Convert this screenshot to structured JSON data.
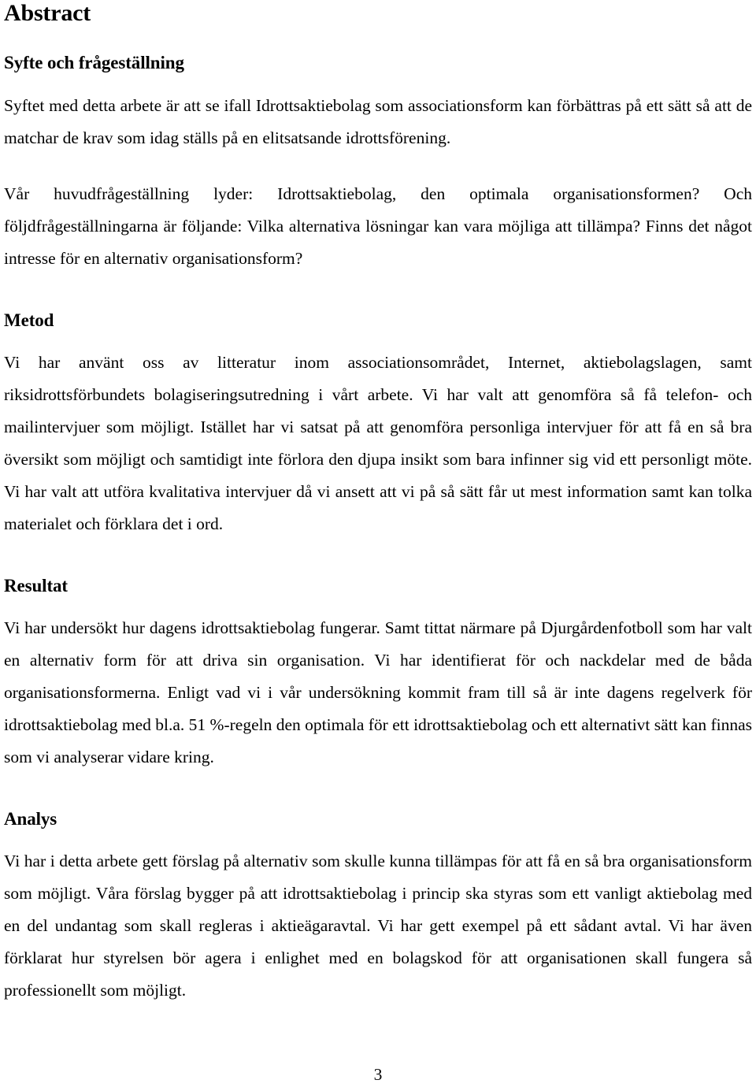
{
  "document": {
    "title": "Abstract",
    "page_number": "3",
    "sections": [
      {
        "id": "syfte",
        "heading": "Syfte och frågeställning",
        "paragraphs": [
          "Syftet med detta arbete är att se ifall Idrottsaktiebolag som associationsform kan förbättras på ett sätt så att de matchar de krav som idag ställs på en elitsatsande idrottsförening.",
          "Vår huvudfrågeställning lyder: Idrottsaktiebolag, den optimala organisationsformen? Och följdfrågeställningarna är följande: Vilka alternativa lösningar kan vara möjliga att tillämpa? Finns det något intresse för en alternativ organisationsform?"
        ]
      },
      {
        "id": "metod",
        "heading": "Metod",
        "paragraphs": [
          "Vi har använt oss av litteratur inom associationsområdet, Internet, aktiebolagslagen, samt riksidrottsförbundets bolagiseringsutredning i vårt arbete. Vi har valt att genomföra så få telefon- och mailintervjuer som möjligt. Istället har vi satsat på att genomföra personliga intervjuer för att få en så bra översikt som möjligt och samtidigt inte förlora den djupa insikt som bara infinner sig vid ett personligt möte. Vi har valt att utföra kvalitativa intervjuer då vi ansett att vi på så sätt får ut mest information samt kan tolka materialet och förklara det i ord."
        ]
      },
      {
        "id": "resultat",
        "heading": "Resultat",
        "paragraphs": [
          "Vi har undersökt hur dagens idrottsaktiebolag fungerar.  Samt tittat närmare på Djurgårdenfotboll som har valt en alternativ form för att driva sin organisation. Vi har identifierat för och nackdelar med de båda organisationsformerna. Enligt vad vi i vår undersökning kommit fram till så är inte dagens regelverk för idrottsaktiebolag med bl.a. 51 %-regeln den optimala för ett idrottsaktiebolag och ett alternativt sätt kan finnas som vi analyserar vidare kring."
        ]
      },
      {
        "id": "analys",
        "heading": "Analys",
        "paragraphs": [
          "Vi har i detta arbete gett förslag på alternativ som skulle kunna tillämpas för att få en så bra organisationsform som möjligt. Våra förslag bygger på att idrottsaktiebolag i princip ska styras som ett vanligt aktiebolag med en del undantag som skall regleras i aktieägaravtal. Vi har gett exempel på ett sådant avtal. Vi har även förklarat hur styrelsen bör agera i enlighet med en bolagskod för att organisationen skall fungera så professionellt som möjligt."
        ]
      }
    ]
  }
}
